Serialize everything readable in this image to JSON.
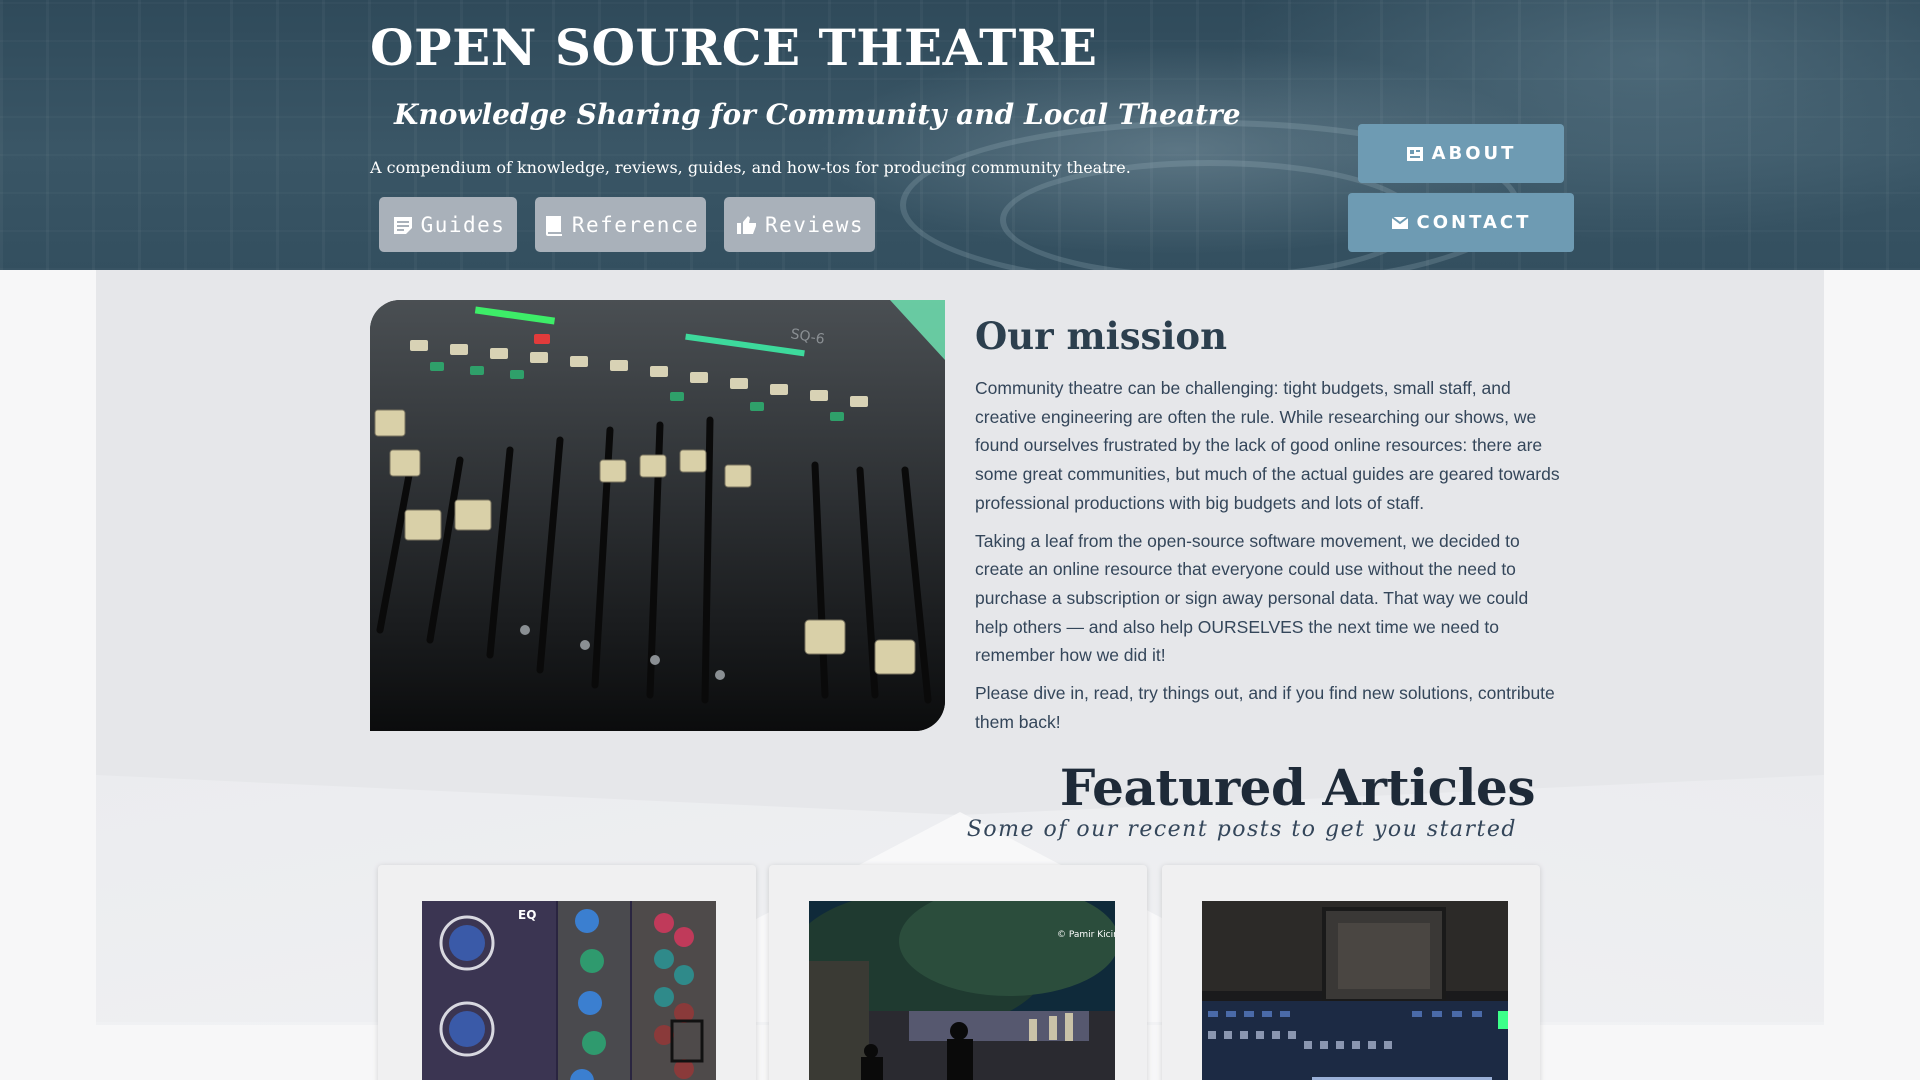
{
  "header": {
    "title": "OPEN SOURCE THEATRE",
    "tagline": "Knowledge Sharing for Community and Local Theatre",
    "blurb": "A compendium of knowledge, reviews, guides, and how-tos for producing community theatre.",
    "nav": [
      {
        "label": "Guides",
        "icon": "note-icon"
      },
      {
        "label": "Reference",
        "icon": "book-icon"
      },
      {
        "label": "Reviews",
        "icon": "thumbs-up-icon"
      }
    ],
    "side_buttons": [
      {
        "label": "ABOUT",
        "icon": "info-card-icon"
      },
      {
        "label": "CONTACT",
        "icon": "mail-icon"
      }
    ]
  },
  "mission": {
    "heading": "Our mission",
    "paragraphs": [
      "Community theatre can be challenging: tight budgets, small staff, and creative engineering are often the rule. While researching our shows, we found ourselves frustrated by the lack of good online resources: there are some great communities, but much of the actual guides are geared towards professional productions with big budgets and lots of staff.",
      "Taking a leaf from the open-source software movement, we decided to create an online resource that everyone could use without the need to purchase a subscription or sign away personal data. That way we could help others — and also help OURSELVES the next time we need to remember how we did it!",
      "Please dive in, read, try things out, and if you find new solutions, contribute them back!"
    ],
    "image_label": "SQ-6"
  },
  "featured": {
    "heading": "Featured Articles",
    "subheading": "Some of our recent posts to get you started",
    "cards": [
      {
        "image": "eq-module-photo",
        "caption_overlay": "EQ"
      },
      {
        "image": "outdoor-stage-photo",
        "caption_overlay": "© Pamir Kiciman"
      },
      {
        "image": "mixing-console-photo",
        "caption_overlay": ""
      }
    ]
  },
  "colors": {
    "hero_bg": "#334f5f",
    "nav_button": "#a9b1ba",
    "side_button": "#6e9bb3",
    "heading": "#2c3f4e",
    "body_text": "#34465a",
    "content_band": "#e6e7ea"
  }
}
